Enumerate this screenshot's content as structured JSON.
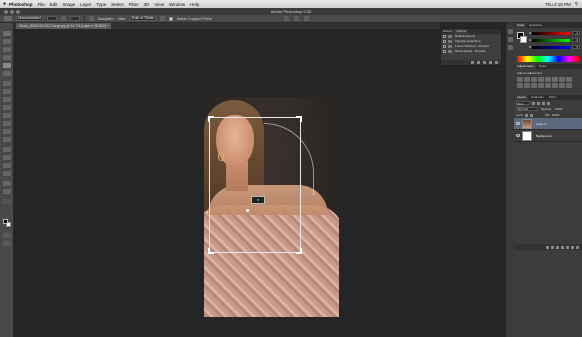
{
  "menubar": {
    "apple_icon": "",
    "items": [
      "Photoshop",
      "File",
      "Edit",
      "Image",
      "Layer",
      "Type",
      "Select",
      "Filter",
      "3D",
      "View",
      "Window",
      "Help"
    ],
    "right_status": "Thu 4:15 PM"
  },
  "titlebar": {
    "title": "Adobe Photoshop CS6"
  },
  "optionsbar": {
    "ratio_value": "Unconstrained",
    "size_w": "",
    "size_h": "",
    "straighten_label": "Straighten",
    "view_label": "View:",
    "view_value": "Rule of Thirds",
    "delete_cropped_label": "Delete Cropped Pixels"
  },
  "document_tab": {
    "label": "iStock_000024471917Large.jpg @ 16.7% (Layer 0, RGB/8) *"
  },
  "history": {
    "tabs": [
      "History",
      "Actions"
    ],
    "rows": [
      "Default Actions",
      "Vignette (selection)",
      "Frame Channel - 50 pixel",
      "Wood Frame - 50 pixel"
    ]
  },
  "color_panel": {
    "tabs": [
      "Color",
      "Swatches"
    ],
    "channels": [
      {
        "label": "R",
        "value": "0"
      },
      {
        "label": "G",
        "value": "0"
      },
      {
        "label": "B",
        "value": "0"
      }
    ]
  },
  "adjustments": {
    "tabs": [
      "Adjustments",
      "Styles"
    ],
    "title": "Add an adjustment"
  },
  "layers": {
    "tabs": [
      "Layers",
      "Channels",
      "Paths"
    ],
    "filter_label": "Kind",
    "blend_mode": "Normal",
    "opacity_label": "Opacity:",
    "opacity_value": "100%",
    "lock_label": "Lock:",
    "fill_label": "Fill:",
    "fill_value": "100%",
    "items": [
      {
        "name": "Layer 0",
        "selected": true
      },
      {
        "name": "Background",
        "selected": false
      }
    ]
  },
  "colors": {
    "accent_selection": "#5b6a7c",
    "canvas_bg": "#252525",
    "panel_bg": "#3c3c3c"
  }
}
